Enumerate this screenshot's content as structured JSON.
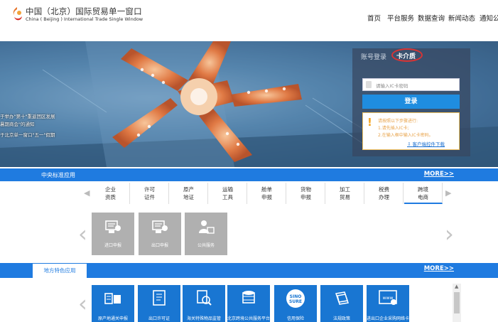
{
  "header": {
    "title_cn": "中国（北京）国际贸易单一窗口",
    "title_en": "China ( Beijing ) International Trade Single Window",
    "nav": [
      "首页",
      "平台服务",
      "数据查询",
      "新闻动态",
      "通知公"
    ]
  },
  "hero": {
    "news": [
      "于举办\"第十\"重返团区发展",
      "暑期商会\"的通知",
      "于北京单一窗口\"五一\"假期"
    ]
  },
  "login": {
    "tab_account": "账号登录",
    "tab_card": "卡介质",
    "password_placeholder": "请输入IC卡密码",
    "login_button": "登录",
    "tip_lines": [
      "请按照以下步骤进行:",
      "1.请先插入IC卡;",
      "2.在输入框中输入IC卡密码。"
    ],
    "client_download": "客户端控件下载"
  },
  "central": {
    "title": "中央标准应用",
    "more": "MORE>>",
    "tabs": [
      {
        "line1": "企业",
        "line2": "资质"
      },
      {
        "line1": "许可",
        "line2": "证件"
      },
      {
        "line1": "原产",
        "line2": "地证"
      },
      {
        "line1": "运输",
        "line2": "工具"
      },
      {
        "line1": "舱单",
        "line2": "申报"
      },
      {
        "line1": "货物",
        "line2": "申报"
      },
      {
        "line1": "加工",
        "line2": "贸易"
      },
      {
        "line1": "税费",
        "line2": "办理"
      },
      {
        "line1": "跨境",
        "line2": "电商"
      }
    ],
    "tiles": [
      "进口申报",
      "出口申报",
      "公共服务"
    ]
  },
  "local": {
    "title": "地方特色应用",
    "more": "MORE>>",
    "tiles": [
      "原产地通关申报",
      "出口许可证",
      "海关特殊物品监管",
      "北京跨境公共服务平台",
      "信用保险",
      "法规政策",
      "进出口企业采购网络卡"
    ]
  },
  "icons": {
    "logo": "beijing-single-window-logo",
    "arrow_left": "‹",
    "arrow_right": "›",
    "sinosure": "SINO SURE"
  },
  "colors": {
    "accent": "#1f7be0",
    "tile_blue": "#1976d2",
    "tile_grey": "#b0b0b0",
    "highlight_ring": "#d93434"
  }
}
